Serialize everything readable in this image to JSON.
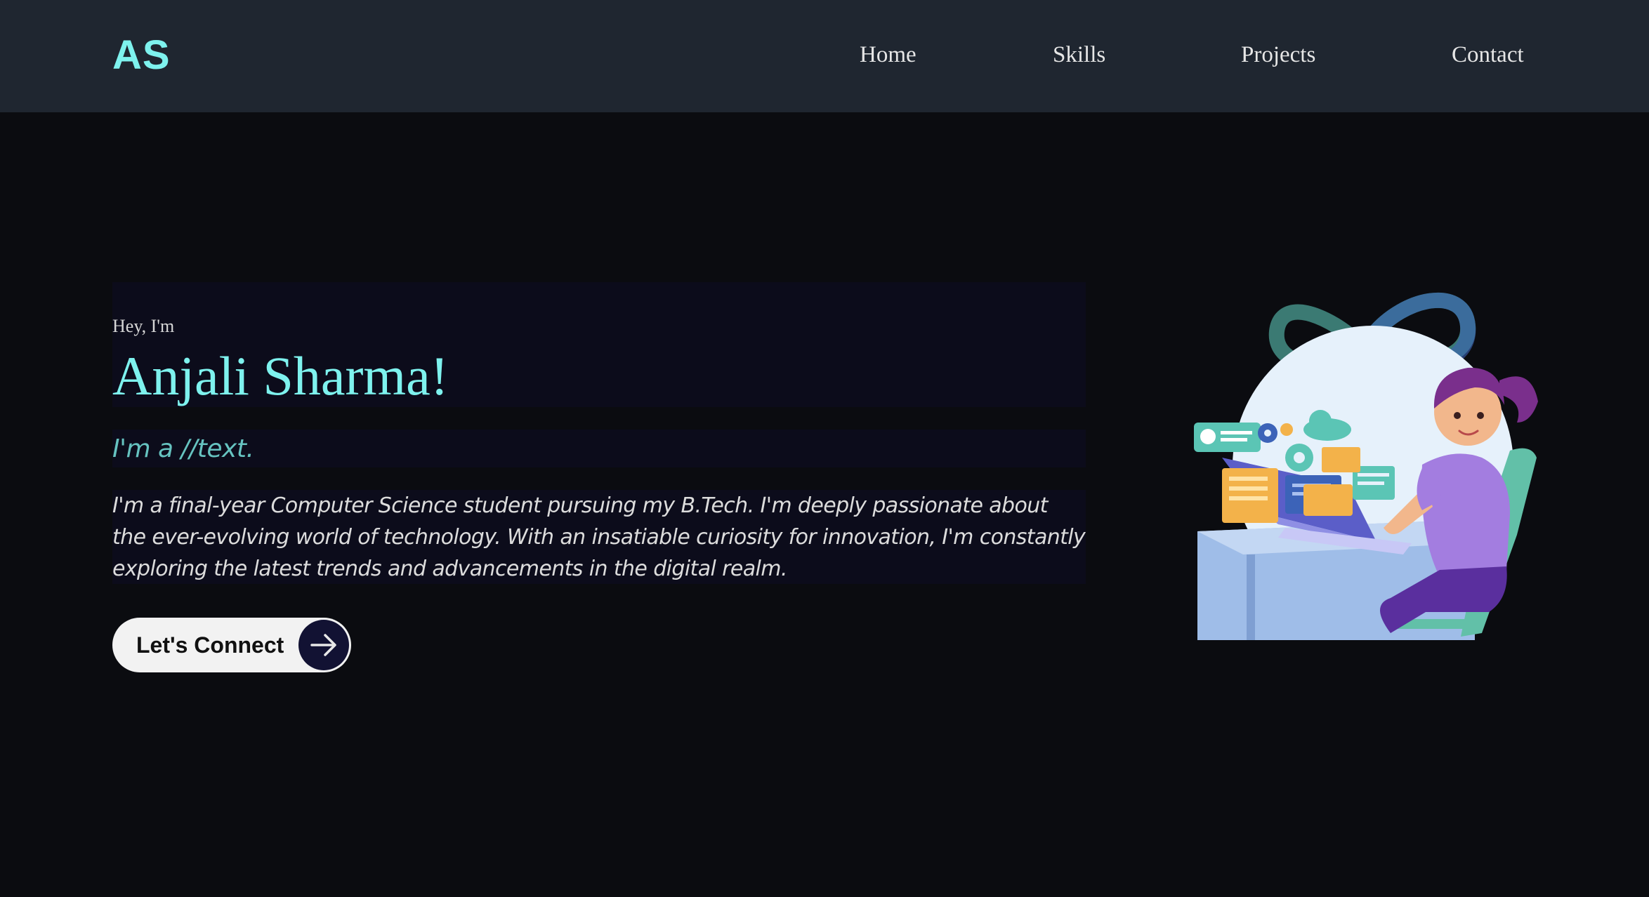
{
  "nav": {
    "logo": "AS",
    "items": [
      {
        "label": "Home"
      },
      {
        "label": "Skills"
      },
      {
        "label": "Projects"
      },
      {
        "label": "Contact"
      }
    ]
  },
  "hero": {
    "greeting": "Hey, I'm",
    "name": "Anjali Sharma!",
    "role": "I'm a //text.",
    "bio": "I'm a final-year Computer Science student pursuing my B.Tech. I'm deeply passionate about the ever-evolving world of technology. With an insatiable curiosity for innovation, I'm constantly exploring the latest trends and advancements in the digital realm.",
    "cta_label": "Let's Connect",
    "cta_icon": "arrow-right-icon"
  },
  "colors": {
    "accent": "#7ef2ee",
    "navbar_bg": "#1f2630",
    "page_bg": "#0b0c10",
    "text_box_bg": "#0c0c1b",
    "role_text": "#66c3c0"
  },
  "illustration": {
    "icon": "developer-illustration"
  }
}
